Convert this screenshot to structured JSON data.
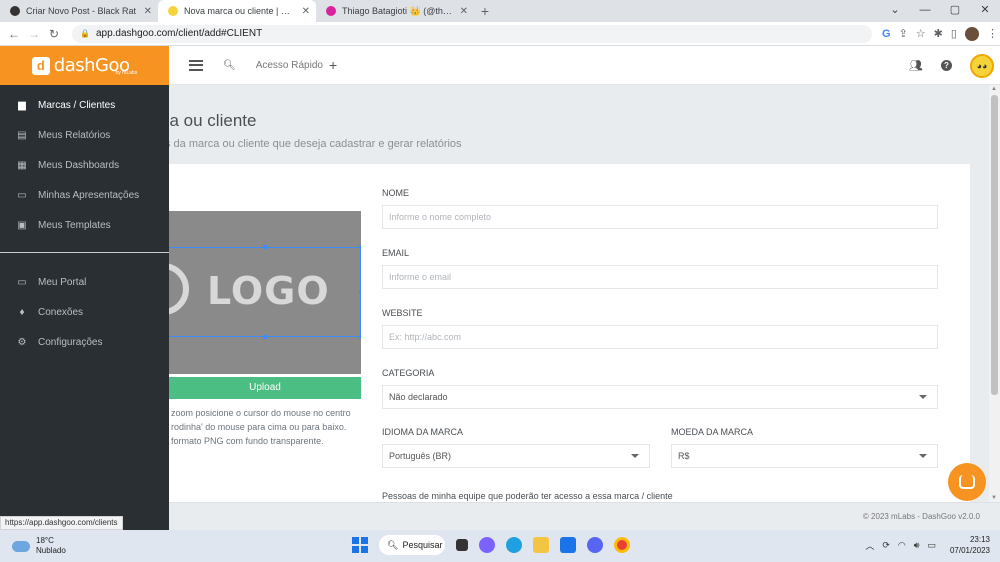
{
  "browser": {
    "tabs": [
      {
        "title": "Criar Novo Post - Black Rat",
        "color": "#333333",
        "active": false
      },
      {
        "title": "Nova marca ou cliente | DashGoo",
        "color": "#f7d33b",
        "active": true
      },
      {
        "title": "Thiago Batagioti 👑 (@thiago.ba",
        "color": "#d6249f",
        "active": false
      }
    ],
    "url": "app.dashgoo.com/client/add#CLIENT",
    "status_url": "https://app.dashgoo.com/clients"
  },
  "sidebar": {
    "logo_text": "dashGoo",
    "logo_mark": "d",
    "logo_sub": "by mLabs",
    "items_top": [
      {
        "label": "Marcas / Clientes",
        "icon": "briefcase-icon",
        "glyph": "▆"
      },
      {
        "label": "Meus Relatórios",
        "icon": "report-icon",
        "glyph": "▤"
      },
      {
        "label": "Meus Dashboards",
        "icon": "dashboard-icon",
        "glyph": "▦"
      },
      {
        "label": "Minhas Apresentações",
        "icon": "presentation-icon",
        "glyph": "▭"
      },
      {
        "label": "Meus Templates",
        "icon": "templates-icon",
        "glyph": "▣"
      }
    ],
    "items_bottom": [
      {
        "label": "Meu Portal",
        "icon": "monitor-icon",
        "glyph": "▭"
      },
      {
        "label": "Conexões",
        "icon": "plug-icon",
        "glyph": "♦"
      },
      {
        "label": "Configurações",
        "icon": "gear-icon",
        "glyph": "⚙"
      }
    ]
  },
  "header": {
    "quick_access": "Acesso Rápido"
  },
  "page": {
    "title": "ca ou cliente",
    "subtitle": "s da marca ou cliente que deseja cadastrar e gerar relatórios"
  },
  "logo_upload": {
    "preview_text": "LOGO",
    "upload_label": "Upload",
    "hint_lines": [
      "zoom posicione o cursor do mouse no centro",
      "rodinha' do mouse para cima ou para baixo.",
      "formato PNG com fundo transparente."
    ]
  },
  "form": {
    "name": {
      "label": "NOME",
      "placeholder": "Informe o nome completo"
    },
    "email": {
      "label": "EMAIL",
      "placeholder": "Informe o email"
    },
    "website": {
      "label": "WEBSITE",
      "placeholder": "Ex: http://abc.com"
    },
    "category": {
      "label": "CATEGORIA",
      "value": "Não declarado"
    },
    "language": {
      "label": "IDIOMA DA MARCA",
      "value": "Português (BR)"
    },
    "currency": {
      "label": "MOEDA DA MARCA",
      "value": "R$"
    },
    "team_label": "Pessoas de minha equipe que poderão ter acesso a essa marca / cliente"
  },
  "footer": {
    "text": "© 2023 mLabs - DashGoo  v2.0.0"
  },
  "taskbar": {
    "temp": "18°C",
    "weather": "Nublado",
    "search": "Pesquisar",
    "time": "23:13",
    "date": "07/01/2023"
  },
  "colors": {
    "brand": "#f79321",
    "sidebar_bg": "#2a2f33",
    "upload_green": "#4bbf83"
  }
}
